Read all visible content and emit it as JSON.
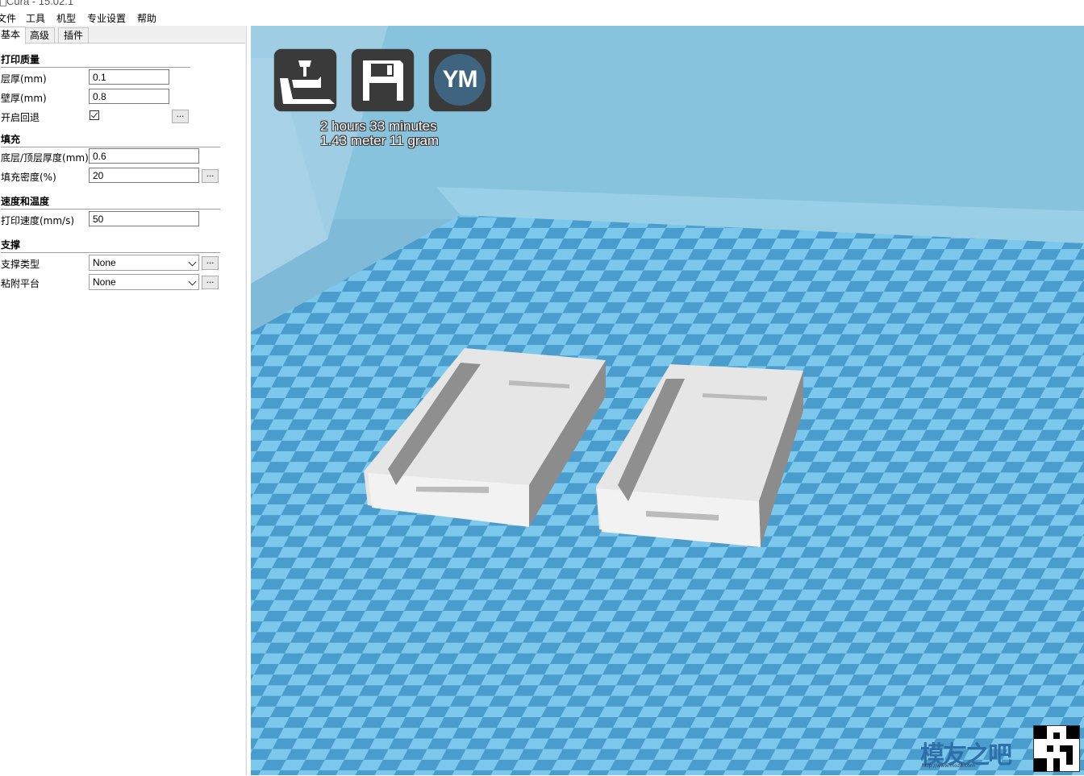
{
  "window": {
    "title": "Cura - 15.02.1"
  },
  "menu": [
    "文件",
    "工具",
    "机型",
    "专业设置",
    "帮助"
  ],
  "tabs": [
    "基本",
    "高级",
    "插件"
  ],
  "sections": {
    "print_quality": "打印质量",
    "fill": "填充",
    "speed_temp": "速度和温度",
    "support": "支撑"
  },
  "fields": {
    "layer_height": {
      "label": "层厚(mm)",
      "value": "0.1"
    },
    "shell_thickness": {
      "label": "壁厚(mm)",
      "value": "0.8"
    },
    "retraction": {
      "label": "开启回退",
      "checked": true
    },
    "bottom_top": {
      "label": "底层/顶层厚度(mm)",
      "value": "0.6"
    },
    "fill_density": {
      "label": "填充密度(%)",
      "value": "20"
    },
    "print_speed": {
      "label": "打印速度(mm/s)",
      "value": "50"
    },
    "support_type": {
      "label": "支撑类型",
      "value": "None"
    },
    "platform_adhesion": {
      "label": "粘附平台",
      "value": "None"
    }
  },
  "more_button": "...",
  "viewport": {
    "toolbar": [
      "load-icon",
      "save-icon",
      "ym-icon"
    ],
    "ym_label": "YM",
    "print_time": "2 hours 33 minutes",
    "print_material": "1.43 meter 11 gram",
    "watermark": "模友之吧",
    "watermark_url": "http://www.moz8.com",
    "colors": {
      "grid_light": "#7cc8ec",
      "grid_dark": "#4a9ccc",
      "model": "#e8e8e8"
    }
  }
}
